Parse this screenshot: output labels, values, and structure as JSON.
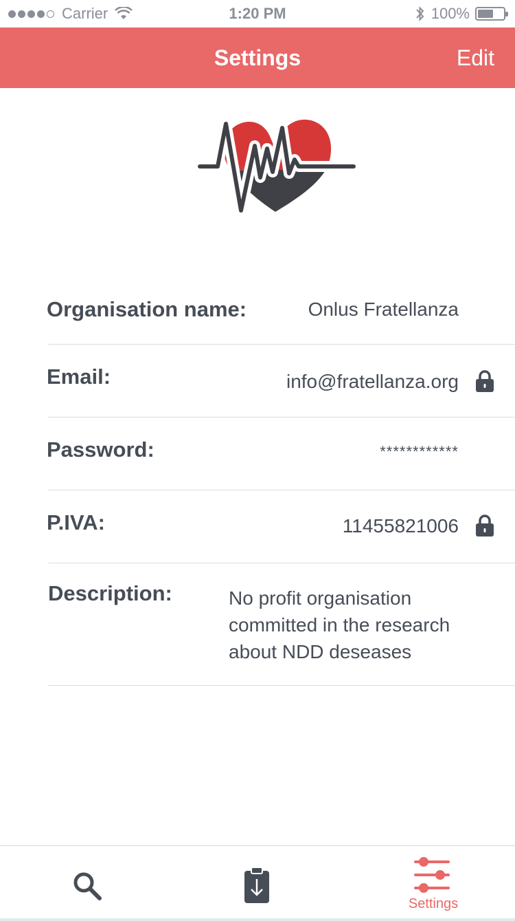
{
  "status_bar": {
    "carrier": "Carrier",
    "time": "1:20 PM",
    "battery": "100%"
  },
  "nav": {
    "title": "Settings",
    "edit_label": "Edit"
  },
  "logo": {
    "icon": "heartbeat-heart-logo",
    "heart_color": "#d63838",
    "line_color": "#3f4146"
  },
  "fields": {
    "organisation_label": "Organisation name:",
    "organisation_value": "Onlus Fratellanza",
    "email_label": "Email:",
    "email_value": "info@fratellanza.org",
    "password_label": "Password:",
    "password_value": "************",
    "piva_label": "P.IVA:",
    "piva_value": "11455821006",
    "description_label": "Description:",
    "description_value": "No profit organisation committed in the research about NDD deseases"
  },
  "tab_bar": {
    "tabs": [
      {
        "icon": "search-icon",
        "label": ""
      },
      {
        "icon": "clipboard-download-icon",
        "label": ""
      },
      {
        "icon": "sliders-icon",
        "label": "Settings",
        "active": true
      }
    ]
  },
  "colors": {
    "accent": "#e96868",
    "text": "#474d57",
    "icon": "#474d57"
  }
}
